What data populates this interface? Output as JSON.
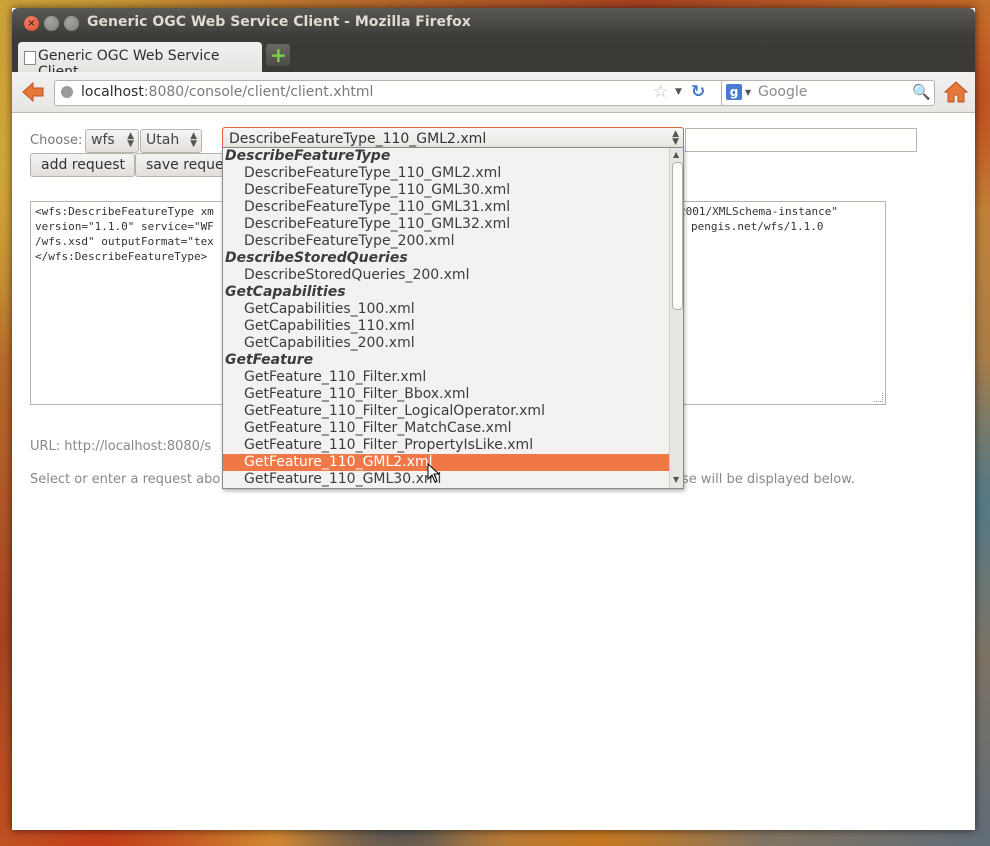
{
  "window": {
    "title": "Generic OGC Web Service Client - Mozilla Firefox"
  },
  "tab": {
    "label": "Generic OGC Web Service Client",
    "new_tab_icon": "plus-icon"
  },
  "nav": {
    "url_host": "localhost",
    "url_rest": ":8080/console/client/client.xhtml",
    "search_placeholder": "Google"
  },
  "form": {
    "choose_label": "Choose:",
    "service_value": "wfs",
    "instance_value": "Utah",
    "request_value": "DescribeFeatureType_110_GML2.xml",
    "extra_input_value": "",
    "add_request_label": "add request",
    "save_request_label": "save reques"
  },
  "xml": {
    "line1_left": "<wfs:DescribeFeatureType xm",
    "line1_right": "2001/XMLSchema-instance\"",
    "line2_left": "version=\"1.1.0\" service=\"WF",
    "line2_right": "pengis.net/wfs/1.1.0",
    "line3_left": "/wfs.xsd\" outputFormat=\"tex",
    "line4_left": "</wfs:DescribeFeatureType>"
  },
  "info": {
    "url_text": "URL: http://localhost:8080/s",
    "hint_left": "Select or enter a request abo",
    "hint_right": "se will be displayed below."
  },
  "dropdown": {
    "groups": [
      {
        "label": "DescribeFeatureType",
        "options": [
          "DescribeFeatureType_110_GML2.xml",
          "DescribeFeatureType_110_GML30.xml",
          "DescribeFeatureType_110_GML31.xml",
          "DescribeFeatureType_110_GML32.xml",
          "DescribeFeatureType_200.xml"
        ]
      },
      {
        "label": "DescribeStoredQueries",
        "options": [
          "DescribeStoredQueries_200.xml"
        ]
      },
      {
        "label": "GetCapabilities",
        "options": [
          "GetCapabilities_100.xml",
          "GetCapabilities_110.xml",
          "GetCapabilities_200.xml"
        ]
      },
      {
        "label": "GetFeature",
        "options": [
          "GetFeature_110_Filter.xml",
          "GetFeature_110_Filter_Bbox.xml",
          "GetFeature_110_Filter_LogicalOperator.xml",
          "GetFeature_110_Filter_MatchCase.xml",
          "GetFeature_110_Filter_PropertyIsLike.xml",
          "GetFeature_110_GML2.xml",
          "GetFeature_110_GML30.xml"
        ]
      }
    ],
    "highlighted": "GetFeature_110_GML2.xml"
  },
  "colors": {
    "accent": "#f07746",
    "focus_border": "#e3633a"
  }
}
